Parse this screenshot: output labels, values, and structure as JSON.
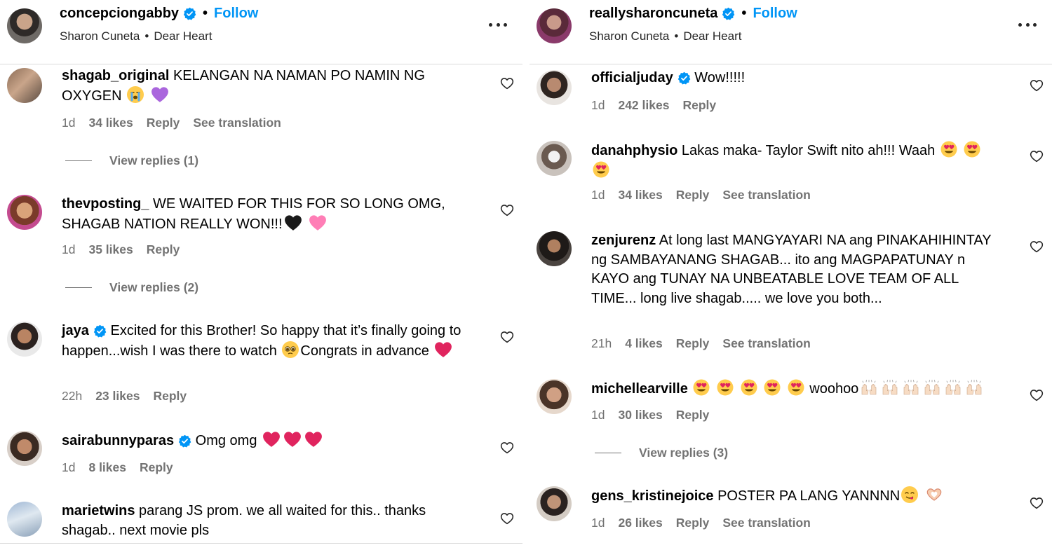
{
  "left": {
    "header": {
      "username": "concepciongabby",
      "follow": "Follow",
      "artist": "Sharon Cuneta",
      "song": "Dear Heart"
    },
    "comments": [
      {
        "username": "shagab_original",
        "text": "KELANGAN NA NAMAN PO NAMIN NG OXYGEN",
        "time": "1d",
        "likes": "34 likes",
        "reply": "Reply",
        "translate": "See translation",
        "view_replies": "View replies (1)"
      },
      {
        "username": "thevposting_",
        "text": "WE WAITED FOR THIS FOR SO LONG OMG, SHAGAB NATION REALLY WON!!!",
        "time": "1d",
        "likes": "35 likes",
        "reply": "Reply",
        "view_replies": "View replies (2)"
      },
      {
        "username": "jaya",
        "text": "Excited for this Brother! So happy that it’s finally going to happen...wish I was there to watch",
        "text2": "Congrats in advance",
        "time": "22h",
        "likes": "23 likes",
        "reply": "Reply"
      },
      {
        "username": "sairabunnyparas",
        "text": "Omg omg",
        "time": "1d",
        "likes": "8 likes",
        "reply": "Reply"
      },
      {
        "username": "marietwins",
        "text": "parang JS prom. we all waited for this.. thanks shagab.. next movie pls"
      }
    ]
  },
  "right": {
    "header": {
      "username": "reallysharoncuneta",
      "follow": "Follow",
      "artist": "Sharon Cuneta",
      "song": "Dear Heart"
    },
    "comments": [
      {
        "username": "officialjuday",
        "text": "Wow!!!!!",
        "time": "1d",
        "likes": "242 likes",
        "reply": "Reply"
      },
      {
        "username": "danahphysio",
        "text": "Lakas maka- Taylor Swift nito ah!!! Waah",
        "time": "1d",
        "likes": "34 likes",
        "reply": "Reply",
        "translate": "See translation"
      },
      {
        "username": "zenjurenz",
        "text": "At long last MANGYAYARI NA ang PINAKAHIHINTAY ng SAMBAYANANG SHAGAB... ito ang MAGPAPATUNAY n KAYO ang TUNAY NA UNBEATABLE LOVE TEAM OF ALL TIME... long live shagab..... we love you both...",
        "time": "21h",
        "likes": "4 likes",
        "reply": "Reply",
        "translate": "See translation"
      },
      {
        "username": "michellearville",
        "text": "woohoo",
        "time": "1d",
        "likes": "30 likes",
        "reply": "Reply",
        "view_replies": "View replies (3)"
      },
      {
        "username": "gens_kristinejoice",
        "text": "POSTER PA LANG YANNNN",
        "time": "1d",
        "likes": "26 likes",
        "reply": "Reply",
        "translate": "See translation"
      }
    ]
  },
  "colors": {
    "link_blue": "#0095f6",
    "verified_blue": "#0095f6",
    "meta_gray": "#737373",
    "divider": "#dbdbdb",
    "heart_red": "#e0245e"
  },
  "icons": [
    "verified-badge-icon",
    "more-options-icon",
    "heart-outline-icon",
    "sob-emoji-icon",
    "purple-heart-emoji-icon",
    "black-heart-emoji-icon",
    "sparkling-heart-emoji-icon",
    "red-heart-emoji-icon",
    "pleading-face-emoji-icon",
    "heart-eyes-emoji-icon",
    "raising-hands-emoji-icon",
    "yum-face-emoji-icon",
    "heart-hands-emoji-icon"
  ]
}
